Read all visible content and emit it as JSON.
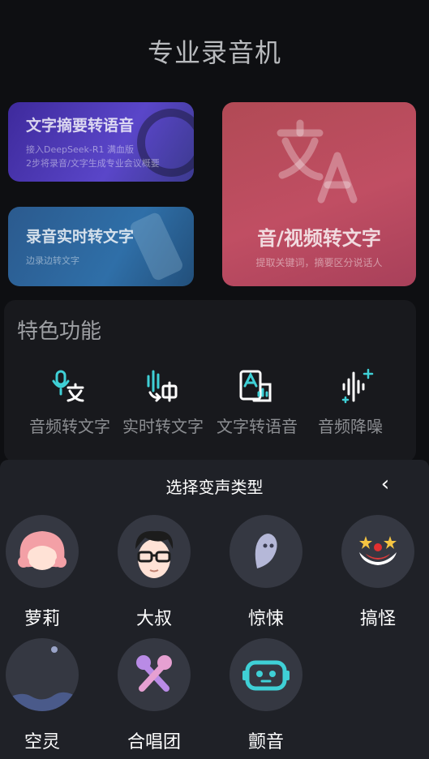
{
  "header": {
    "title": "专业录音机"
  },
  "cards": {
    "summary": {
      "title": "文字摘要转语音",
      "sub1": "接入DeepSeek-R1 满血版",
      "sub2": "2步将录音/文字生成专业会议概要"
    },
    "realtime": {
      "title": "录音实时转文字",
      "sub": "边录边转文字"
    },
    "av": {
      "title": "音/视频转文字",
      "sub": "提取关键词，摘要区分说话人"
    }
  },
  "features": {
    "title": "特色功能",
    "items": [
      {
        "label": "音频转文字",
        "icon": "audio-to-text-icon"
      },
      {
        "label": "实时转文字",
        "icon": "realtime-text-icon"
      },
      {
        "label": "文字转语音",
        "icon": "text-to-speech-icon"
      },
      {
        "label": "音频降噪",
        "icon": "noise-reduction-icon"
      }
    ]
  },
  "sheet": {
    "title": "选择变声类型",
    "back": "‹",
    "voices": [
      {
        "label": "萝莉",
        "icon": "loli-icon"
      },
      {
        "label": "大叔",
        "icon": "uncle-icon"
      },
      {
        "label": "惊悚",
        "icon": "ghost-icon"
      },
      {
        "label": "搞怪",
        "icon": "clown-icon"
      },
      {
        "label": "空灵",
        "icon": "ethereal-icon"
      },
      {
        "label": "合唱团",
        "icon": "chorus-icon"
      },
      {
        "label": "颤音",
        "icon": "robot-icon"
      }
    ]
  },
  "colors": {
    "accent": "#3fd0d6",
    "sheet_bg": "#1f2127",
    "bg": "#0e0f12"
  }
}
